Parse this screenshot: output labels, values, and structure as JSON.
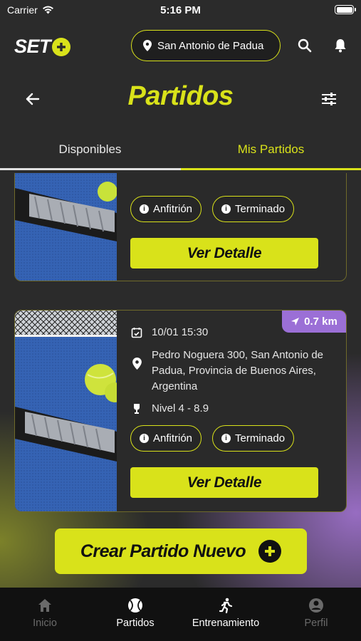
{
  "status_bar": {
    "carrier": "Carrier",
    "time": "5:16 PM"
  },
  "header": {
    "logo_text": "SET",
    "location": "San Antonio de Padua",
    "icons": [
      "location-pin-icon",
      "search-icon",
      "bell-icon"
    ]
  },
  "title_row": {
    "title": "Partidos"
  },
  "tabs": [
    {
      "label": "Disponibles",
      "active": false
    },
    {
      "label": "Mis Partidos",
      "active": true
    }
  ],
  "matches": [
    {
      "badges": [
        "Anfitrión",
        "Terminado"
      ],
      "button_label": "Ver Detalle"
    },
    {
      "distance": "0.7 km",
      "datetime": "10/01 15:30",
      "address": "Pedro Noguera 300, San Antonio de Padua, Provincia de Buenos Aires, Argentina",
      "level": "Nivel 4 - 8.9",
      "badges": [
        "Anfitrión",
        "Terminado"
      ],
      "button_label": "Ver Detalle"
    }
  ],
  "create_button": {
    "label": "Crear Partido Nuevo"
  },
  "bottom_nav": [
    {
      "label": "Inicio",
      "icon": "home-icon",
      "active": false
    },
    {
      "label": "Partidos",
      "icon": "tennis-ball-icon",
      "active": true
    },
    {
      "label": "Entrenamiento",
      "icon": "running-icon",
      "active": true
    },
    {
      "label": "Perfil",
      "icon": "profile-icon",
      "active": false
    }
  ],
  "colors": {
    "accent": "#d9e21a",
    "purple": "#9b6fd6",
    "background": "#2b2b2b",
    "nav": "#111111"
  }
}
